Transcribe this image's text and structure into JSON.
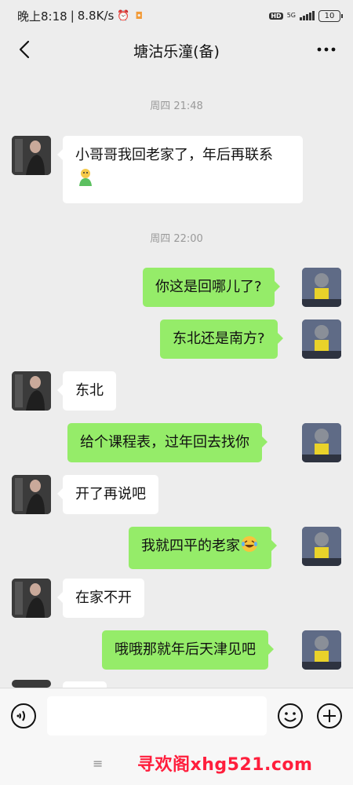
{
  "status_bar": {
    "time": "晚上8:18",
    "speed": "8.8K/s",
    "hd": "HD",
    "network": "5G",
    "battery": "10"
  },
  "header": {
    "title": "塘沽乐潼(备)"
  },
  "chat": {
    "timestamps": [
      "周四 21:48",
      "周四 22:00"
    ],
    "messages": [
      {
        "side": "left",
        "text": "小哥哥我回老家了，年后再联系"
      },
      {
        "side": "right",
        "text": "你这是回哪儿了?"
      },
      {
        "side": "right",
        "text": "东北还是南方?"
      },
      {
        "side": "left",
        "text": "东北"
      },
      {
        "side": "right",
        "text": "给个课程表，过年回去找你"
      },
      {
        "side": "left",
        "text": "开了再说吧"
      },
      {
        "side": "right",
        "text": "我就四平的老家"
      },
      {
        "side": "left",
        "text": "在家不开"
      },
      {
        "side": "right",
        "text": "哦哦那就年后天津见吧"
      }
    ]
  },
  "input_bar": {
    "placeholder": ""
  },
  "watermark": "寻欢阁xhg521.com",
  "colors": {
    "background": "#ededed",
    "bubble_right": "#95ec69",
    "bubble_left": "#ffffff",
    "watermark": "#ff1e3c"
  }
}
